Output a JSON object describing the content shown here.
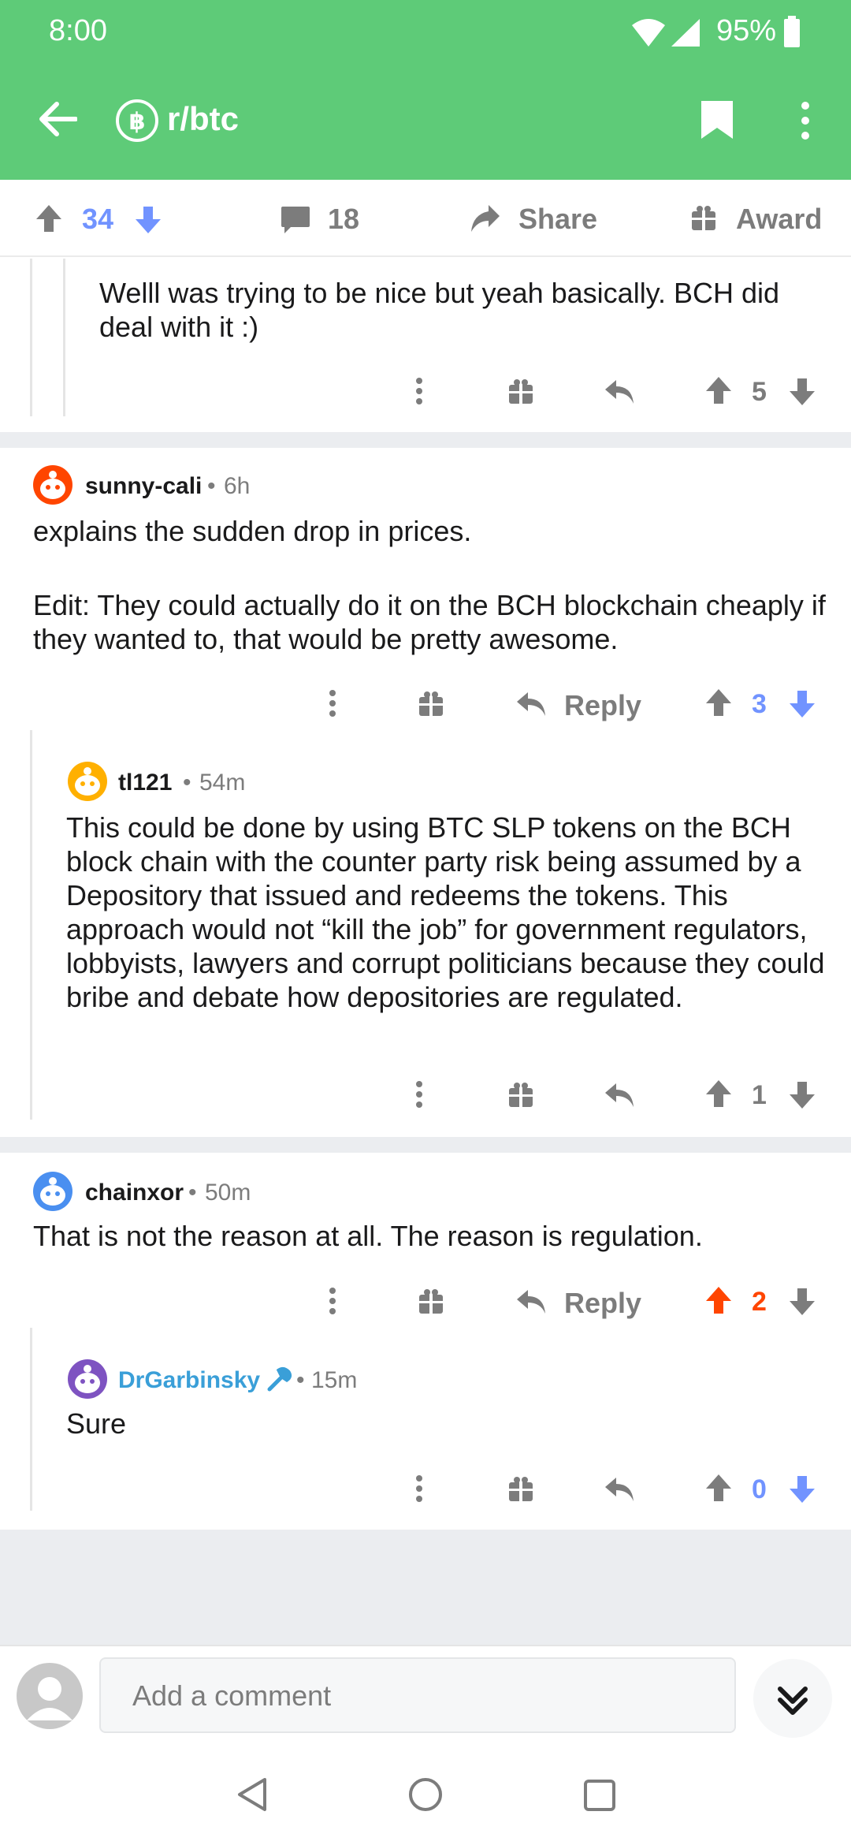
{
  "status_bar": {
    "time": "8:00",
    "battery": "95%"
  },
  "header": {
    "subreddit": "r/btc"
  },
  "action_bar": {
    "score": "34",
    "comments": "18",
    "share_label": "Share",
    "award_label": "Award"
  },
  "comments": [
    {
      "text": "Welll was trying to be nice but yeah basically. BCH did deal with it :)",
      "score": "5"
    },
    {
      "user": "sunny-cali",
      "age": "6h",
      "text_lines": [
        "explains the sudden drop in prices.",
        "",
        "Edit: They could actually do it on the BCH blockchain cheaply if they wanted to, that would be pretty awesome."
      ],
      "reply_label": "Reply",
      "score": "3"
    },
    {
      "user": "tl121",
      "age": "54m",
      "text": "This could be done by using BTC SLP tokens on the BCH block chain with the counter party risk being assumed by a Depository that issued and redeems the tokens. This approach would not  “kill the job” for government regulators, lobbyists, lawyers and corrupt politicians because they could bribe and debate how depositories are regulated.",
      "score": "1"
    },
    {
      "user": "chainxor",
      "age": "50m",
      "text": "That is not the reason at all. The reason is regulation.",
      "reply_label": "Reply",
      "score": "2"
    },
    {
      "user": "DrGarbinsky",
      "age": "15m",
      "text": "Sure",
      "score": "0"
    }
  ],
  "separator": "•",
  "composer": {
    "placeholder": "Add a comment"
  },
  "colors": {
    "header_bg": "#5ecb78",
    "upvote_orange": "#ff4500",
    "downvote_blue": "#7193ff",
    "mod_blue": "#3a9fd8",
    "muted_gray": "#7c7c7c"
  }
}
